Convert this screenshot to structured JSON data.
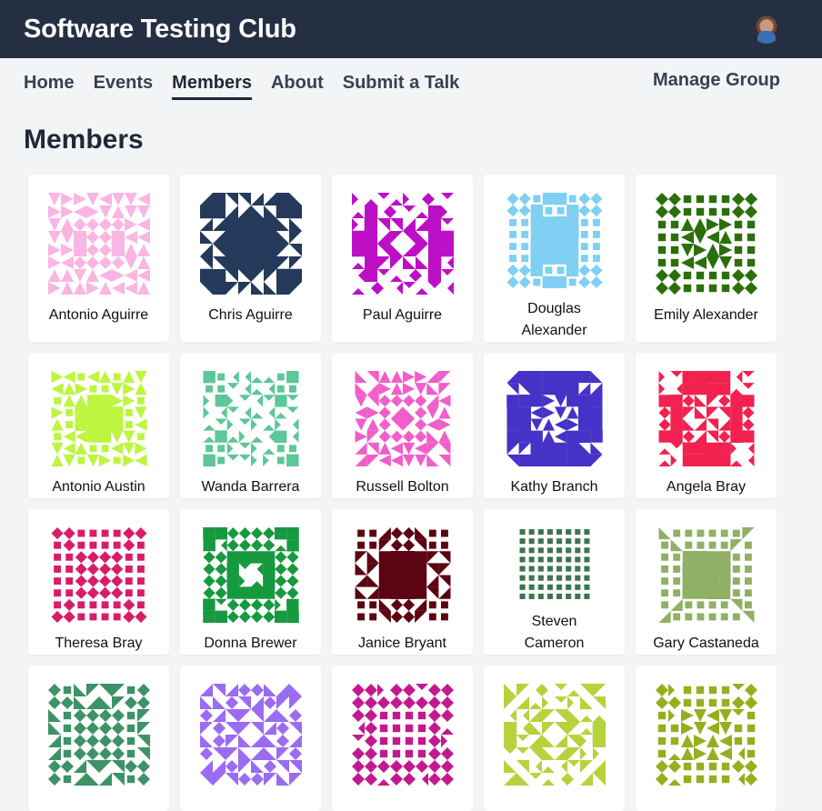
{
  "header": {
    "title": "Software Testing Club"
  },
  "nav": {
    "links": [
      "Home",
      "Events",
      "Members",
      "About",
      "Submit a Talk"
    ],
    "active": "Members",
    "manage_label": "Manage Group"
  },
  "page_title": "Members",
  "members": [
    {
      "name": "Antonio Aguirre",
      "color": "#f9b6e2"
    },
    {
      "name": "Chris Aguirre",
      "color": "#25395b"
    },
    {
      "name": "Paul Aguirre",
      "color": "#bd0fc6"
    },
    {
      "name": "Douglas Alexander",
      "color": "#7fd0f2"
    },
    {
      "name": "Emily Alexander",
      "color": "#2a6f0b"
    },
    {
      "name": "Antonio Austin",
      "color": "#bdf53f"
    },
    {
      "name": "Wanda Barrera",
      "color": "#5cc797"
    },
    {
      "name": "Russell Bolton",
      "color": "#f05fc9"
    },
    {
      "name": "Kathy Branch",
      "color": "#4632c7"
    },
    {
      "name": "Angela Bray",
      "color": "#f2214f"
    },
    {
      "name": "Theresa Bray",
      "color": "#d81c6a"
    },
    {
      "name": "Donna Brewer",
      "color": "#17993f"
    },
    {
      "name": "Janice Bryant",
      "color": "#5c0411"
    },
    {
      "name": "Steven Cameron",
      "color": "#3f7351"
    },
    {
      "name": "Gary Castaneda",
      "color": "#8fb065"
    },
    {
      "name": "",
      "color": "#3d9267"
    },
    {
      "name": "",
      "color": "#9a6cf2"
    },
    {
      "name": "",
      "color": "#c21a8e"
    },
    {
      "name": "",
      "color": "#b6d33b"
    },
    {
      "name": "",
      "color": "#98ae1e"
    }
  ]
}
